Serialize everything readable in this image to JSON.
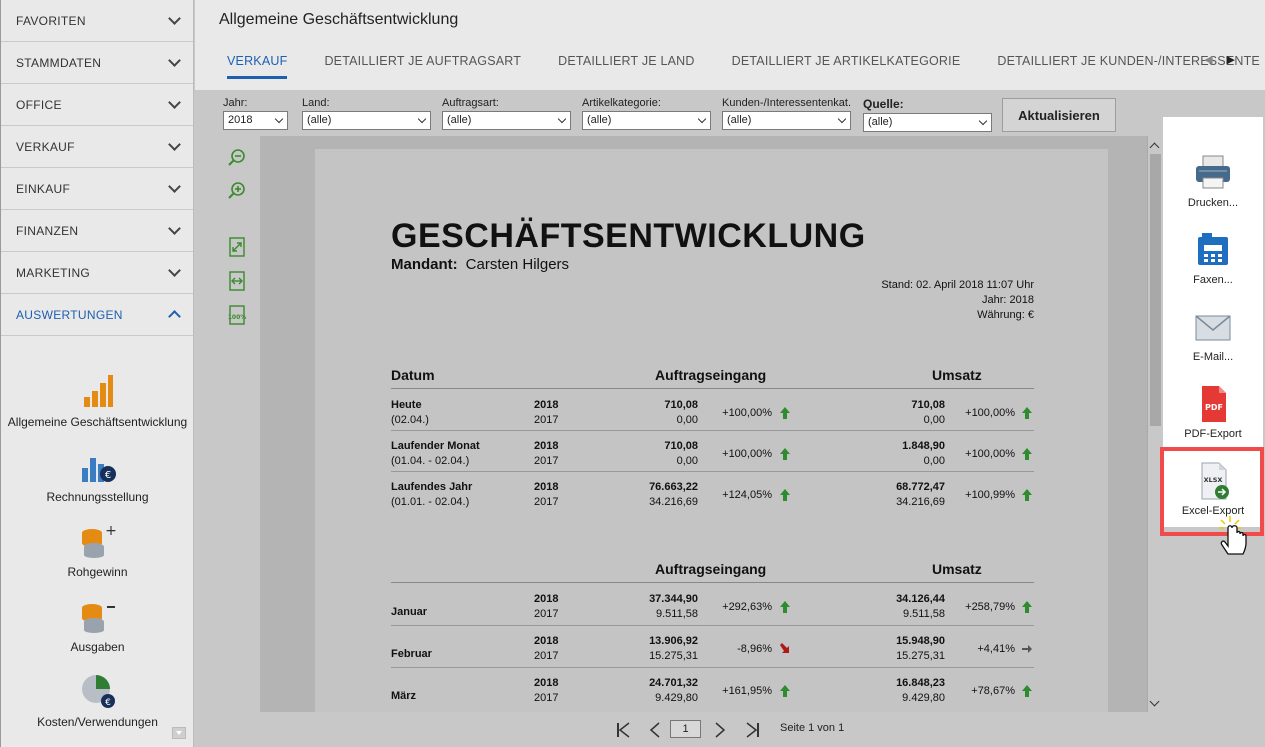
{
  "sidebar": {
    "nav": [
      {
        "label": "FAVORITEN"
      },
      {
        "label": "STAMMDATEN"
      },
      {
        "label": "OFFICE"
      },
      {
        "label": "VERKAUF"
      },
      {
        "label": "EINKAUF"
      },
      {
        "label": "FINANZEN"
      },
      {
        "label": "MARKETING"
      },
      {
        "label": "AUSWERTUNGEN"
      }
    ],
    "reports": [
      {
        "label": "Allgemeine Geschäftsentwicklung",
        "icon": "bar-chart-icon"
      },
      {
        "label": "Rechnungsstellung",
        "icon": "invoice-chart-icon"
      },
      {
        "label": "Rohgewinn",
        "icon": "coins-plus-icon"
      },
      {
        "label": "Ausgaben",
        "icon": "coins-minus-icon"
      },
      {
        "label": "Kosten/Verwendungen",
        "icon": "pie-euro-icon"
      }
    ]
  },
  "header": {
    "title": "Allgemeine Geschäftsentwicklung",
    "tabs": [
      {
        "label": "VERKAUF"
      },
      {
        "label": "DETAILLIERT JE AUFTRAGSART"
      },
      {
        "label": "DETAILLIERT JE LAND"
      },
      {
        "label": "DETAILLIERT JE ARTIKELKATEGORIE"
      },
      {
        "label": "DETAILLIERT JE KUNDEN-/INTERESSENTE"
      }
    ]
  },
  "filters": {
    "year": {
      "label": "Jahr:",
      "value": "2018"
    },
    "country": {
      "label": "Land:",
      "value": "(alle)"
    },
    "order_type": {
      "label": "Auftragsart:",
      "value": "(alle)"
    },
    "category": {
      "label": "Artikelkategorie:",
      "value": "(alle)"
    },
    "customer_cat": {
      "label": "Kunden-/Interessentenkat.",
      "value": "(alle)"
    },
    "source": {
      "label": "Quelle:",
      "value": "(alle)"
    },
    "refresh_label": "Aktualisieren"
  },
  "report": {
    "title": "GESCHÄFTSENTWICKLUNG",
    "mandant_label": "Mandant:",
    "mandant_value": "Carsten Hilgers",
    "meta": {
      "stand": "Stand:  02. April 2018 11:07 Uhr",
      "jahr": "Jahr: 2018",
      "waehrung": "Währung: €"
    },
    "section1": {
      "col_date": "Datum",
      "col_orders": "Auftragseingang",
      "col_revenue": "Umsatz"
    },
    "rows1": [
      {
        "label": "Heute",
        "sub": "(02.04.)",
        "y1": "2018",
        "y2": "2017",
        "o1": "710,08",
        "o2": "0,00",
        "opct": "+100,00%",
        "otrend": "up",
        "u1": "710,08",
        "u2": "0,00",
        "upct": "+100,00%",
        "utrend": "up"
      },
      {
        "label": "Laufender Monat",
        "sub": "(01.04. - 02.04.)",
        "y1": "2018",
        "y2": "2017",
        "o1": "710,08",
        "o2": "0,00",
        "opct": "+100,00%",
        "otrend": "up",
        "u1": "1.848,90",
        "u2": "0,00",
        "upct": "+100,00%",
        "utrend": "up"
      },
      {
        "label": "Laufendes Jahr",
        "sub": "(01.01. - 02.04.)",
        "y1": "2018",
        "y2": "2017",
        "o1": "76.663,22",
        "o2": "34.216,69",
        "opct": "+124,05%",
        "otrend": "up",
        "u1": "68.772,47",
        "u2": "34.216,69",
        "upct": "+100,99%",
        "utrend": "up"
      }
    ],
    "section2": {
      "col_orders": "Auftragseingang",
      "col_revenue": "Umsatz"
    },
    "rows2": [
      {
        "label": "Januar",
        "y1": "2018",
        "y2": "2017",
        "o1": "37.344,90",
        "o2": "9.511,58",
        "opct": "+292,63%",
        "otrend": "up",
        "u1": "34.126,44",
        "u2": "9.511,58",
        "upct": "+258,79%",
        "utrend": "up"
      },
      {
        "label": "Februar",
        "y1": "2018",
        "y2": "2017",
        "o1": "13.906,92",
        "o2": "15.275,31",
        "opct": "-8,96%",
        "otrend": "down",
        "u1": "15.948,90",
        "u2": "15.275,31",
        "upct": "+4,41%",
        "utrend": "flat"
      },
      {
        "label": "März",
        "y1": "2018",
        "y2": "2017",
        "o1": "24.701,32",
        "o2": "9.429,80",
        "opct": "+161,95%",
        "otrend": "up",
        "u1": "16.848,23",
        "u2": "9.429,80",
        "upct": "+78,67%",
        "utrend": "up"
      }
    ]
  },
  "pager": {
    "page": "1",
    "text": "Seite 1 von 1"
  },
  "export": [
    {
      "label": "Drucken...",
      "icon": "printer-icon"
    },
    {
      "label": "Faxen...",
      "icon": "fax-icon"
    },
    {
      "label": "E-Mail...",
      "icon": "mail-icon"
    },
    {
      "label": "PDF-Export",
      "icon": "pdf-icon",
      "badge": "PDF"
    },
    {
      "label": "Excel-Export",
      "icon": "xlsx-icon",
      "badge": "XLSX"
    }
  ],
  "colors": {
    "accent": "#1f5fb0",
    "highlight": "#f04a4a",
    "trend_up": "#2e8b2e",
    "trend_down": "#b01818"
  }
}
